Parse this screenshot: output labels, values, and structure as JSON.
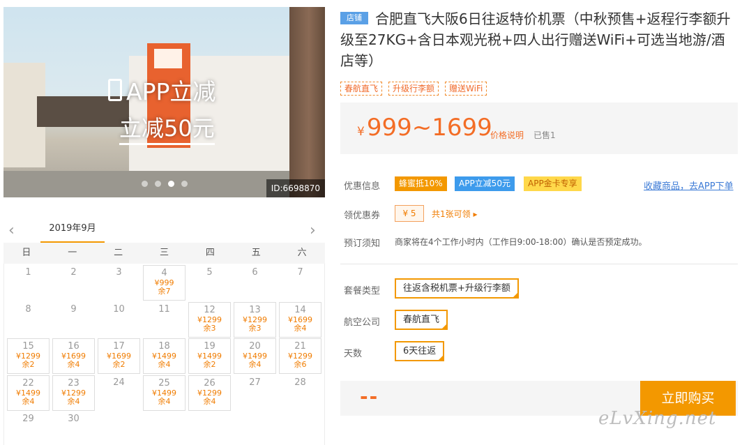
{
  "hero": {
    "promo_line1": "APP立减",
    "promo_line2": "立减50元",
    "id_tag": "ID:6698870"
  },
  "calendar": {
    "month": "2019年9月",
    "weekdays": [
      "日",
      "一",
      "二",
      "三",
      "四",
      "五",
      "六"
    ],
    "days": [
      {
        "d": "1"
      },
      {
        "d": "2"
      },
      {
        "d": "3"
      },
      {
        "d": "4",
        "price": "¥999",
        "left": "余7"
      },
      {
        "d": "5"
      },
      {
        "d": "6"
      },
      {
        "d": "7"
      },
      {
        "d": "8"
      },
      {
        "d": "9"
      },
      {
        "d": "10"
      },
      {
        "d": "11"
      },
      {
        "d": "12",
        "price": "¥1299",
        "left": "余3"
      },
      {
        "d": "13",
        "price": "¥1299",
        "left": "余3"
      },
      {
        "d": "14",
        "price": "¥1699",
        "left": "余4"
      },
      {
        "d": "15",
        "price": "¥1299",
        "left": "余2"
      },
      {
        "d": "16",
        "price": "¥1699",
        "left": "余4"
      },
      {
        "d": "17",
        "price": "¥1699",
        "left": "余2"
      },
      {
        "d": "18",
        "price": "¥1499",
        "left": "余4"
      },
      {
        "d": "19",
        "price": "¥1499",
        "left": "余2"
      },
      {
        "d": "20",
        "price": "¥1499",
        "left": "余4"
      },
      {
        "d": "21",
        "price": "¥1299",
        "left": "余6"
      },
      {
        "d": "22",
        "price": "¥1499",
        "left": "余4"
      },
      {
        "d": "23",
        "price": "¥1299",
        "left": "余4"
      },
      {
        "d": "24"
      },
      {
        "d": "25",
        "price": "¥1499",
        "left": "余4"
      },
      {
        "d": "26",
        "price": "¥1299",
        "left": "余4"
      },
      {
        "d": "27"
      },
      {
        "d": "28"
      },
      {
        "d": "29"
      },
      {
        "d": "30"
      }
    ]
  },
  "product": {
    "shop_tag": "店铺",
    "title": "合肥直飞大阪6日往返特价机票（中秋预售+返程行李额升级至27KG+含日本观光税+四人出行赠送WiFi+可选当地游/酒店等）",
    "tags": [
      "春航直飞",
      "升级行李额",
      "赠送WiFi"
    ],
    "price_symbol": "¥",
    "price_range": "999~1699",
    "price_explain": "价格说明",
    "sold": "已售1"
  },
  "offers": {
    "label": "优惠信息",
    "badges": [
      "蜂蜜抵10%",
      "APP立减50元",
      "APP金卡专享"
    ],
    "fav_link": "收藏商品，去APP下单",
    "coupon_label": "领优惠券",
    "coupon_value": "¥ 5",
    "coupon_count": "共1张可领 ▸",
    "notice_label": "预订须知",
    "notice_text": "商家将在4个工作小时内（工作日9:00-18:00）确认是否预定成功。"
  },
  "options": {
    "package_label": "套餐类型",
    "package_value": "往返含税机票+升级行李额",
    "airline_label": "航空公司",
    "airline_value": "春航直飞",
    "days_label": "天数",
    "days_value": "6天往返"
  },
  "buy": {
    "total": "--",
    "button": "立即购买"
  },
  "watermark": "eLvXing.net",
  "colors": {
    "accent": "#f39800",
    "price": "#f36d26",
    "blue": "#3d9bec"
  }
}
